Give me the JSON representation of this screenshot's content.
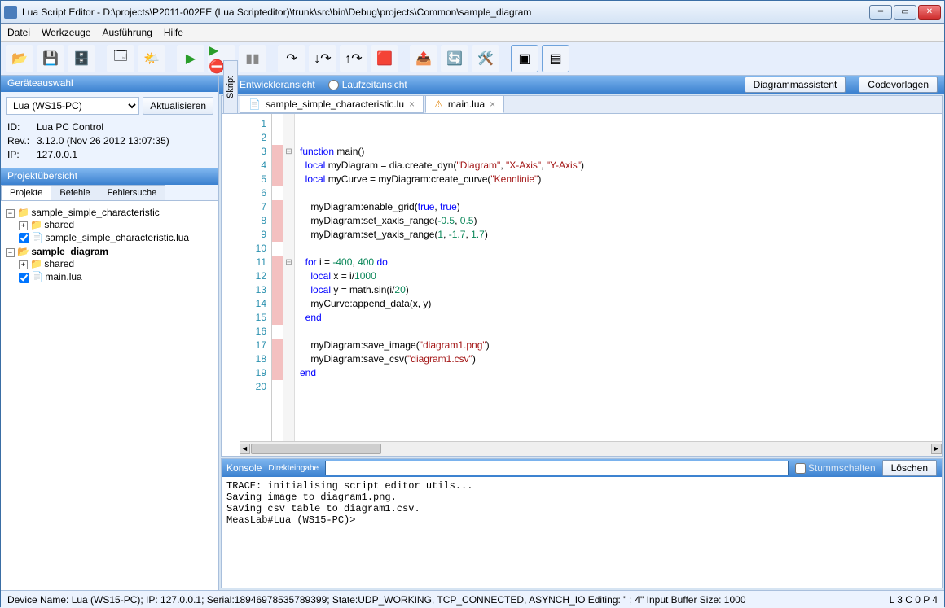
{
  "window": {
    "title": "Lua Script Editor - D:\\projects\\P2011-002FE (Lua Scripteditor)\\trunk\\src\\bin\\Debug\\projects\\Common\\sample_diagram"
  },
  "menu": {
    "items": [
      "Datei",
      "Werkzeuge",
      "Ausführung",
      "Hilfe"
    ]
  },
  "left": {
    "device_hdr": "Geräteauswahl",
    "device_name": "Lua (WS15-PC)",
    "refresh": "Aktualisieren",
    "info_id_lbl": "ID:",
    "info_id": "Lua PC Control",
    "info_rev_lbl": "Rev.:",
    "info_rev": "3.12.0 (Nov 26 2012 13:07:35)",
    "info_ip_lbl": "IP:",
    "info_ip": "127.0.0.1",
    "project_hdr": "Projektübersicht",
    "tabs": [
      "Projekte",
      "Befehle",
      "Fehlersuche"
    ],
    "tree": {
      "p1": "sample_simple_characteristic",
      "p1_shared": "shared",
      "p1_file": "sample_simple_characteristic.lua",
      "p2": "sample_diagram",
      "p2_shared": "shared",
      "p2_file": "main.lua"
    }
  },
  "viewswitch": {
    "dev": "Entwickleransicht",
    "run": "Laufzeitansicht",
    "diag": "Diagrammassistent",
    "tpl": "Codevorlagen"
  },
  "editor": {
    "sidelabel": "Skript",
    "tabs": [
      {
        "name": "sample_simple_characteristic.lu"
      },
      {
        "name": "main.lua",
        "warn": true
      }
    ],
    "code": [
      {
        "n": 1,
        "bp": false,
        "fold": "",
        "html": ""
      },
      {
        "n": 2,
        "bp": false,
        "fold": "",
        "html": ""
      },
      {
        "n": 3,
        "bp": true,
        "fold": "⊟",
        "html": "<span class='kw'>function</span> main()"
      },
      {
        "n": 4,
        "bp": true,
        "fold": "",
        "html": "  <span class='kw'>local</span> myDiagram = dia.create_dyn(<span class='str'>\"Diagram\"</span>, <span class='str'>\"X-Axis\"</span>, <span class='str'>\"Y-Axis\"</span>)"
      },
      {
        "n": 5,
        "bp": true,
        "fold": "",
        "html": "  <span class='kw'>local</span> myCurve = myDiagram:create_curve(<span class='str'>\"Kennlinie\"</span>)"
      },
      {
        "n": 6,
        "bp": false,
        "fold": "",
        "html": ""
      },
      {
        "n": 7,
        "bp": true,
        "fold": "",
        "html": "    myDiagram:enable_grid(<span class='kw'>true</span>, <span class='kw'>true</span>)"
      },
      {
        "n": 8,
        "bp": true,
        "fold": "",
        "html": "    myDiagram:set_xaxis_range(<span class='num'>-0.5</span>, <span class='num'>0.5</span>)"
      },
      {
        "n": 9,
        "bp": true,
        "fold": "",
        "html": "    myDiagram:set_yaxis_range(<span class='num'>1</span>, <span class='num'>-1.7</span>, <span class='num'>1.7</span>)"
      },
      {
        "n": 10,
        "bp": false,
        "fold": "",
        "html": ""
      },
      {
        "n": 11,
        "bp": true,
        "fold": "⊟",
        "html": "  <span class='kw'>for</span> i = <span class='num'>-400</span>, <span class='num'>400</span> <span class='kw'>do</span>"
      },
      {
        "n": 12,
        "bp": true,
        "fold": "",
        "html": "    <span class='kw'>local</span> x = i/<span class='num'>1000</span>"
      },
      {
        "n": 13,
        "bp": true,
        "fold": "",
        "html": "    <span class='kw'>local</span> y = math.sin(i/<span class='num'>20</span>)"
      },
      {
        "n": 14,
        "bp": true,
        "fold": "",
        "html": "    myCurve:append_data(x, y)"
      },
      {
        "n": 15,
        "bp": true,
        "fold": "",
        "html": "  <span class='kw'>end</span>"
      },
      {
        "n": 16,
        "bp": false,
        "fold": "",
        "html": ""
      },
      {
        "n": 17,
        "bp": true,
        "fold": "",
        "html": "    myDiagram:save_image(<span class='str'>\"diagram1.png\"</span>)"
      },
      {
        "n": 18,
        "bp": true,
        "fold": "",
        "html": "    myDiagram:save_csv(<span class='str'>\"diagram1.csv\"</span>)"
      },
      {
        "n": 19,
        "bp": true,
        "fold": "",
        "html": "<span class='kw'>end</span>"
      },
      {
        "n": 20,
        "bp": false,
        "fold": "",
        "html": ""
      }
    ]
  },
  "console": {
    "hdr": "Konsole",
    "direct": "Direkteingabe",
    "mute": "Stummschalten",
    "clear": "Löschen",
    "body": "TRACE: initialising script editor utils...\nSaving image to diagram1.png.\nSaving csv table to diagram1.csv.\nMeasLab#Lua (WS15-PC)>"
  },
  "status": {
    "left": "Device Name: Lua (WS15-PC); IP: 127.0.0.1; Serial:18946978535789399; State:UDP_WORKING, TCP_CONNECTED, ASYNCH_IO  Editing: \" ; 4\"   Input Buffer Size: 1000",
    "right": "L 3  C 0  P 4"
  }
}
